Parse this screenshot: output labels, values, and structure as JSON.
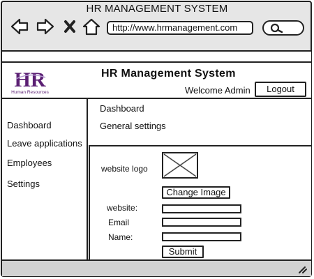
{
  "window": {
    "title": "HR MANAGEMENT SYSTEM"
  },
  "browser": {
    "url": "http://www.hrmanagement.com",
    "nav_icons": [
      "back-arrow-icon",
      "forward-arrow-icon",
      "close-x-icon",
      "home-icon"
    ],
    "search_icon": "search-icon"
  },
  "header": {
    "logo_text": "HR",
    "logo_subtext": "Human Resources",
    "app_title": "HR Management System",
    "welcome": "Welcome Admin",
    "logout_label": "Logout"
  },
  "sidebar": {
    "items": [
      {
        "label": "Dashboard"
      },
      {
        "label": "Leave applications"
      },
      {
        "label": "Employees"
      },
      {
        "label": "Settings"
      }
    ]
  },
  "breadcrumb": {
    "level1": "Dashboard",
    "level2": "General settings"
  },
  "form": {
    "logo_label": "website logo",
    "change_image_label": "Change Image",
    "website_label": "website:",
    "email_label": "Email",
    "name_label": "Name:",
    "submit_label": "Submit"
  },
  "colors": {
    "logo_purple": "#5b1f73",
    "chrome_gray": "#e6e6e6",
    "footer_gray": "#d2d2d2"
  }
}
